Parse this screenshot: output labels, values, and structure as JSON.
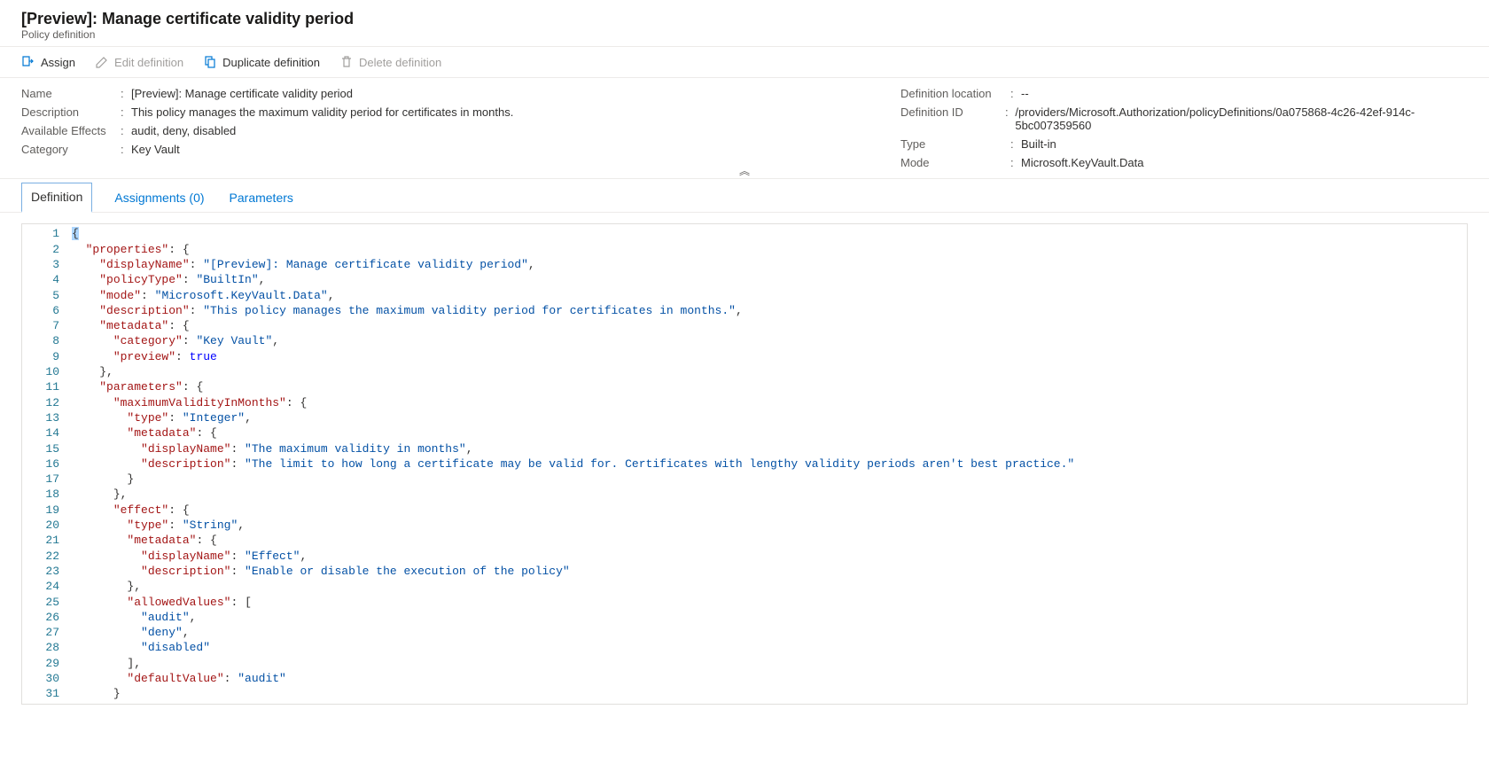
{
  "header": {
    "title": "[Preview]: Manage certificate validity period",
    "subtitle": "Policy definition"
  },
  "toolbar": {
    "assign": "Assign",
    "edit": "Edit definition",
    "duplicate": "Duplicate definition",
    "delete": "Delete definition"
  },
  "essentials": {
    "left": {
      "name_label": "Name",
      "name_value": "[Preview]: Manage certificate validity period",
      "description_label": "Description",
      "description_value": "This policy manages the maximum validity period for certificates in months.",
      "effects_label": "Available Effects",
      "effects_value": "audit, deny, disabled",
      "category_label": "Category",
      "category_value": "Key Vault"
    },
    "right": {
      "location_label": "Definition location",
      "location_value": "--",
      "id_label": "Definition ID",
      "id_value": "/providers/Microsoft.Authorization/policyDefinitions/0a075868-4c26-42ef-914c-5bc007359560",
      "type_label": "Type",
      "type_value": "Built-in",
      "mode_label": "Mode",
      "mode_value": "Microsoft.KeyVault.Data"
    }
  },
  "tabs": {
    "definition": "Definition",
    "assignments": "Assignments (0)",
    "parameters": "Parameters"
  },
  "code_json": {
    "properties": {
      "displayName": "[Preview]: Manage certificate validity period",
      "policyType": "BuiltIn",
      "mode": "Microsoft.KeyVault.Data",
      "description": "This policy manages the maximum validity period for certificates in months.",
      "metadata": {
        "category": "Key Vault",
        "preview": true
      },
      "parameters": {
        "maximumValidityInMonths": {
          "type": "Integer",
          "metadata": {
            "displayName": "The maximum validity in months",
            "description": "The limit to how long a certificate may be valid for. Certificates with lengthy validity periods aren't best practice."
          }
        },
        "effect": {
          "type": "String",
          "metadata": {
            "displayName": "Effect",
            "description": "Enable or disable the execution of the policy"
          },
          "allowedValues": [
            "audit",
            "deny",
            "disabled"
          ],
          "defaultValue": "audit"
        }
      }
    }
  },
  "code_lines": [
    [
      0,
      "brace-sel",
      "{"
    ],
    [
      1,
      "kv",
      "properties",
      null,
      "{"
    ],
    [
      2,
      "kv",
      "displayName",
      "[Preview]: Manage certificate validity period",
      ","
    ],
    [
      2,
      "kv",
      "policyType",
      "BuiltIn",
      ","
    ],
    [
      2,
      "kv",
      "mode",
      "Microsoft.KeyVault.Data",
      ","
    ],
    [
      2,
      "kv",
      "description",
      "This policy manages the maximum validity period for certificates in months.",
      ","
    ],
    [
      2,
      "kv",
      "metadata",
      null,
      "{"
    ],
    [
      3,
      "kv",
      "category",
      "Key Vault",
      ","
    ],
    [
      3,
      "kb",
      "preview",
      true,
      ""
    ],
    [
      2,
      "close",
      "},"
    ],
    [
      2,
      "kv",
      "parameters",
      null,
      "{"
    ],
    [
      3,
      "kv",
      "maximumValidityInMonths",
      null,
      "{"
    ],
    [
      4,
      "kv",
      "type",
      "Integer",
      ","
    ],
    [
      4,
      "kv",
      "metadata",
      null,
      "{"
    ],
    [
      5,
      "kv",
      "displayName",
      "The maximum validity in months",
      ","
    ],
    [
      5,
      "kv",
      "description",
      "The limit to how long a certificate may be valid for. Certificates with lengthy validity periods aren't best practice.",
      ""
    ],
    [
      4,
      "close",
      "}"
    ],
    [
      3,
      "close",
      "},"
    ],
    [
      3,
      "kv",
      "effect",
      null,
      "{"
    ],
    [
      4,
      "kv",
      "type",
      "String",
      ","
    ],
    [
      4,
      "kv",
      "metadata",
      null,
      "{"
    ],
    [
      5,
      "kv",
      "displayName",
      "Effect",
      ","
    ],
    [
      5,
      "kv",
      "description",
      "Enable or disable the execution of the policy",
      ""
    ],
    [
      4,
      "close",
      "},"
    ],
    [
      4,
      "kv",
      "allowedValues",
      null,
      "["
    ],
    [
      5,
      "str",
      "audit",
      ","
    ],
    [
      5,
      "str",
      "deny",
      ","
    ],
    [
      5,
      "str",
      "disabled",
      ""
    ],
    [
      4,
      "close",
      "],"
    ],
    [
      4,
      "kv",
      "defaultValue",
      "audit",
      ""
    ],
    [
      3,
      "close",
      "}"
    ]
  ]
}
